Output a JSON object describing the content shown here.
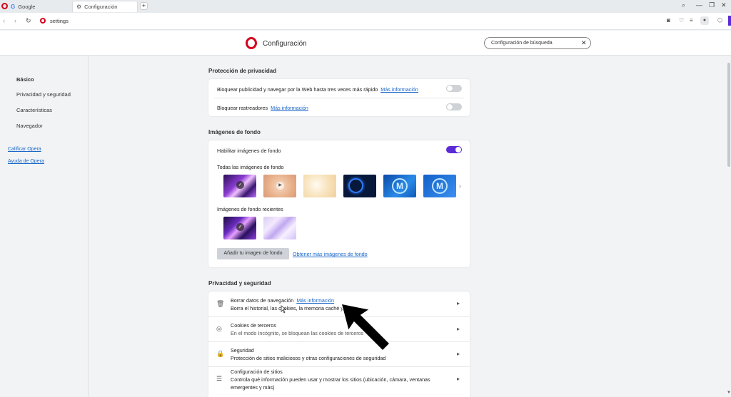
{
  "tabs": [
    {
      "label": "Google"
    },
    {
      "label": "Configuración"
    }
  ],
  "address": {
    "url": "settings"
  },
  "header": {
    "title": "Configuración",
    "search_placeholder": "Configuración de búsqueda"
  },
  "sidebar": {
    "items": [
      {
        "label": "Básico"
      },
      {
        "label": "Privacidad y seguridad"
      },
      {
        "label": "Características"
      },
      {
        "label": "Navegador"
      }
    ],
    "links": [
      {
        "label": "Calificar Opera"
      },
      {
        "label": "Ayuda de Opera"
      }
    ]
  },
  "privacy_protection": {
    "title": "Protección de privacidad",
    "rows": [
      {
        "label": "Bloquear publicidad y navegar por la Web hasta tres veces más rápido",
        "link": "Más información",
        "enabled": false
      },
      {
        "label": "Bloquear rastreadores",
        "link": "Más información",
        "enabled": false
      }
    ]
  },
  "wallpapers": {
    "title": "Imágenes de fondo",
    "enable_label": "Habilitar imágenes de fondo",
    "enabled": true,
    "all_label": "Todas las imágenes de fondo",
    "recent_label": "Imágenes de fondo recientes",
    "add_button": "Añadir tu imagen de fondo",
    "more_link": "Obtener más imágenes de fondo"
  },
  "privacy_security": {
    "title": "Privacidad y seguridad",
    "rows": [
      {
        "title": "Borrar datos de navegación",
        "link": "Más información",
        "desc": "Borra el historial, las cookies, la memoria caché y..."
      },
      {
        "title": "Cookies de terceros",
        "desc": "En el modo Incógnito, se bloquean las cookies de terceros"
      },
      {
        "title": "Seguridad",
        "desc": "Protección de sitios maliciosos y otras configuraciones de seguridad"
      },
      {
        "title": "Configuración de sitios",
        "desc": "Controla qué información pueden usar y mostrar los sitios (ubicación, cámara, ventanas",
        "desc2": "emergentes y más)"
      }
    ]
  },
  "colors": {
    "accent": "#5b2bd6",
    "brand": "#d4001a",
    "link": "#1a66c8"
  }
}
